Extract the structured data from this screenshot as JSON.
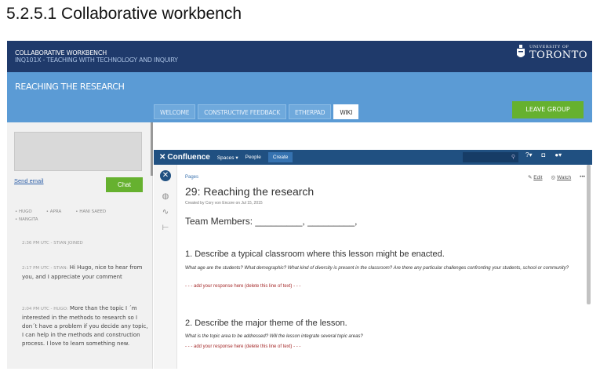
{
  "doc": {
    "heading": "5.2.5.1 Collaborative workbench"
  },
  "header": {
    "course_title": "COLLABORATIVE WORKBENCH",
    "course_sub": "INQ101X - TEACHING WITH TECHNOLOGY AND INQUIRY",
    "uoft_small": "UNIVERSITY OF",
    "uoft_big": "TORONTO"
  },
  "group": {
    "title": "REACHING THE RESEARCH",
    "tabs": [
      "WELCOME",
      "CONSTRUCTIVE FEEDBACK",
      "ETHERPAD",
      "WIKI"
    ],
    "active_tab": "WIKI",
    "leave_label": "LEAVE GROUP"
  },
  "sidebar": {
    "send_email": "Send email",
    "chat_label": "Chat",
    "members": [
      "HUGO",
      "APRA",
      "HANI SAEED",
      "NANGITA"
    ],
    "messages": [
      {
        "meta": "2:36 PM UTC - STIAN JOINED",
        "text": ""
      },
      {
        "meta": "2:17 PM UTC - STIAN:",
        "text": "Hi Hugo, nice to hear from you, and I appreciate your comment"
      },
      {
        "meta": "2:04 PM UTC - HUGO:",
        "text": "More than the topic I ´m interested in the methods to research so I don´t have a problem if you decide any topic, I can help in the methods and construction process. I love to learn something new."
      }
    ]
  },
  "confluence": {
    "logo": "Confluence",
    "nav": {
      "spaces": "Spaces",
      "people": "People",
      "create": "Create"
    },
    "breadcrumb": "Pages",
    "actions": {
      "edit": "Edit",
      "watch": "Watch",
      "more": "•••"
    },
    "page_title": "29: Reaching the research",
    "created_by": "Created by Cory von Encore on Jul 15, 2015",
    "team_members": "Team Members: _________, _________,",
    "questions": [
      {
        "title": "1. Describe a typical classroom where this lesson might be enacted.",
        "desc": "What age are the students? What demographic? What kind of diversity is present in the classroom? Are there any particular challenges confronting your students, school or community?",
        "add": "- - - add your response here (delete this line of text) - - -"
      },
      {
        "title": "2. Describe the major theme of the lesson.",
        "desc": "What is the topic area to be addressed?  Will the lesson integrate several topic areas?",
        "add": "- - - add your response here (delete this line of text) - - -"
      }
    ]
  },
  "colors": {
    "topbar": "#1f3a6b",
    "groupbar": "#5b9bd5",
    "green": "#66b12f",
    "confluence_nav": "#205081"
  },
  "icons": [
    "crest-icon",
    "search-icon",
    "help-icon",
    "notification-icon",
    "user-icon",
    "home-icon",
    "pages-icon",
    "feed-icon",
    "tree-icon",
    "edit-icon",
    "watch-icon"
  ]
}
